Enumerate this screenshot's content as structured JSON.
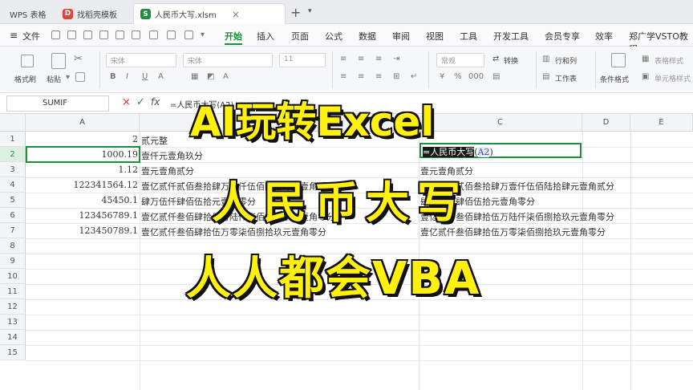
{
  "tabs": {
    "wps": "WPS 表格",
    "template": "找稻壳模板",
    "file": "人民币大写.xlsm",
    "close_glyph": "×",
    "add_glyph": "+",
    "menu_glyph": "▾"
  },
  "menu": {
    "file": "文件",
    "items": [
      "开始",
      "插入",
      "页面",
      "公式",
      "数据",
      "审阅",
      "视图",
      "工具",
      "开发工具",
      "会员专享",
      "效率",
      "郑广学VSTO教程"
    ]
  },
  "ribbon": {
    "format_painter": "格式刷",
    "paste": "粘贴",
    "font_name_1": "宋体",
    "font_name_2": "宋体",
    "font_size": "11",
    "number_format": "常规",
    "convert": "转换",
    "row_col": "行和列",
    "worksheet": "工作表",
    "cond_format": "条件格式",
    "table_style": "表格样式",
    "cell_style": "单元格样式"
  },
  "formula_bar": {
    "name_box": "SUMIF",
    "cancel": "×",
    "confirm": "✓",
    "fx": "fx",
    "content": "=人民币大写(A2)"
  },
  "columns": [
    "A",
    "B",
    "C",
    "D",
    "E"
  ],
  "rows": [
    "1",
    "2",
    "3",
    "4",
    "5",
    "6",
    "7",
    "8",
    "9",
    "10",
    "11",
    "12",
    "13",
    "14",
    "15"
  ],
  "cells": {
    "a": [
      "2",
      "1000.19",
      "1.12",
      "122341564.12",
      "45450.1",
      "123456789.1",
      "123450789.1"
    ],
    "b": [
      "贰元整",
      "壹仟元壹角玖分",
      "壹元壹角贰分",
      "壹亿贰仟贰佰叁拾肆万壹仟伍佰陆拾肆元壹角贰分",
      "肆万伍仟肆佰伍拾元壹角零分",
      "壹亿贰仟叁佰肆拾伍万陆仟柒佰捌拾玖元壹角零分",
      "壹亿贰仟叁佰肆拾伍万零柒佰捌拾玖元壹角零分"
    ],
    "e": [
      "",
      "",
      "壹元壹角贰分",
      "壹亿贰仟贰佰叁拾肆万壹仟伍佰陆拾肆元壹角贰分",
      "肆万伍仟肆佰伍拾元壹角零分",
      "壹亿贰仟叁佰肆拾伍万陆仟柒佰捌拾玖元壹角零分",
      "壹亿贰仟叁佰肆拾伍万零柒佰捌拾玖元壹角零分"
    ]
  },
  "edit_cell": {
    "prefix": "=",
    "func": "人民币大写",
    "open": "(",
    "arg": "A2",
    "close": ")"
  },
  "overlay": {
    "line1": "AI玩转Excel",
    "line2": "人民币大写",
    "line3": "人人都会VBA"
  },
  "colors": {
    "accent": "#1a8f3c",
    "overlay_fill": "#fff10d",
    "overlay_stroke": "#111111"
  }
}
